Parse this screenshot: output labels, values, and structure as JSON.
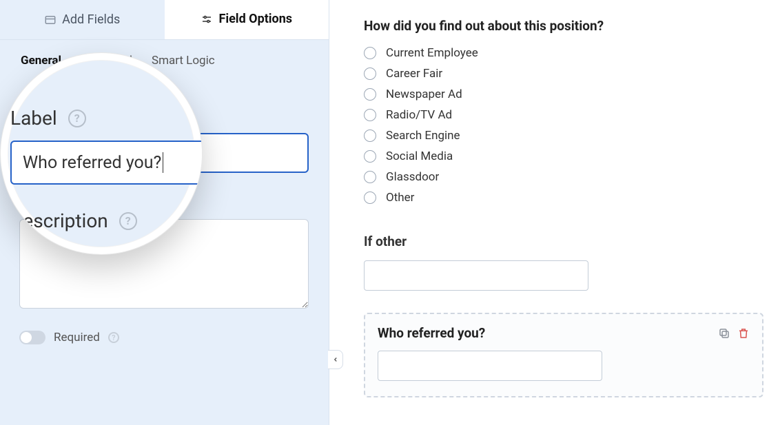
{
  "tabs": {
    "add_fields": "Add Fields",
    "field_options": "Field Options"
  },
  "subtabs": {
    "general": "General",
    "advanced": "Advanced",
    "smart_logic": "Smart Logic"
  },
  "editor": {
    "label_label": "Label",
    "label_value": "Who referred you?",
    "description_label": "Description",
    "description_value": "",
    "required_label": "Required"
  },
  "lens": {
    "label_label": "Label",
    "label_value": "Who referred you?",
    "description_label": "Description"
  },
  "preview": {
    "question1": "How did you find out about this position?",
    "options": [
      "Current Employee",
      "Career Fair",
      "Newspaper Ad",
      "Radio/TV Ad",
      "Search Engine",
      "Social Media",
      "Glassdoor",
      "Other"
    ],
    "if_other_label": "If other",
    "selected_field_label": "Who referred you?"
  }
}
